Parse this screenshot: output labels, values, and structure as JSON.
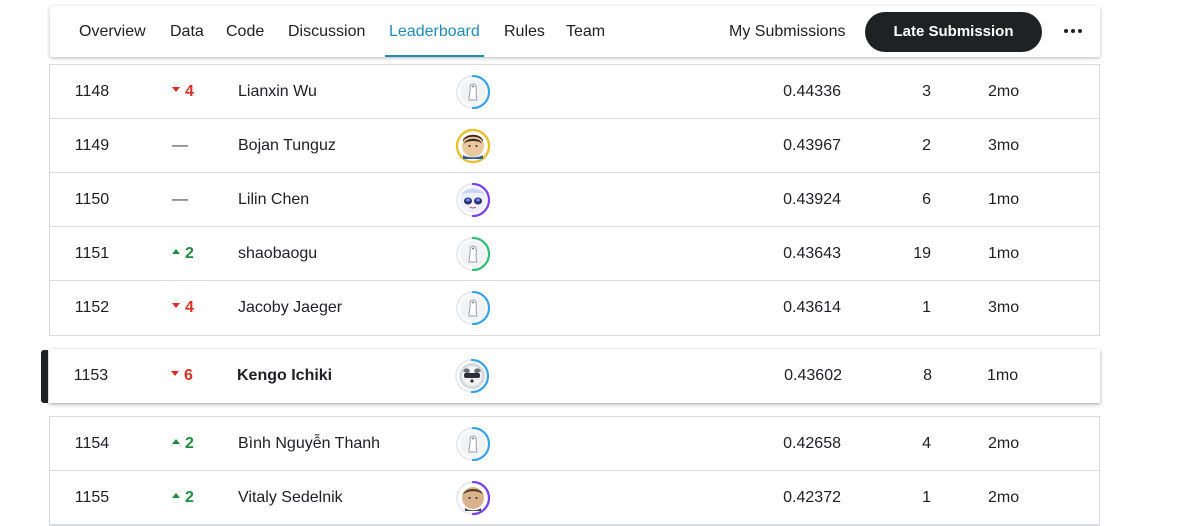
{
  "nav": {
    "tabs": [
      {
        "label": "Overview",
        "id": "overview"
      },
      {
        "label": "Data",
        "id": "data"
      },
      {
        "label": "Code",
        "id": "code"
      },
      {
        "label": "Discussion",
        "id": "discussion"
      },
      {
        "label": "Leaderboard",
        "id": "leaderboard",
        "active": true
      },
      {
        "label": "Rules",
        "id": "rules"
      },
      {
        "label": "Team",
        "id": "team"
      }
    ],
    "my_submissions": "My Submissions",
    "late_submission": "Late Submission",
    "more_icon": "more-horizontal-icon"
  },
  "colors": {
    "accent": "#1f8cb8",
    "rank_up": "#1e8e3e",
    "rank_down": "#d93025",
    "button_dark": "#202124"
  },
  "rows_top": [
    {
      "rank": "1148",
      "trend": "down",
      "change": "4",
      "name": "Lianxin Wu",
      "avatar": "default",
      "ring": "#3aa3e3",
      "score": "0.44336",
      "entries": "3",
      "last": "2mo"
    },
    {
      "rank": "1149",
      "trend": "same",
      "change": "—",
      "name": "Bojan Tunguz",
      "avatar": "photo",
      "ring": "#e8c02d",
      "score": "0.43967",
      "entries": "2",
      "last": "3mo"
    },
    {
      "rank": "1150",
      "trend": "same",
      "change": "—",
      "name": "Lilin Chen",
      "avatar": "anime",
      "ring": "#7a3ef0",
      "score": "0.43924",
      "entries": "6",
      "last": "1mo"
    },
    {
      "rank": "1151",
      "trend": "up",
      "change": "2",
      "name": "shaobaogu",
      "avatar": "default",
      "ring": "#2fbf71",
      "score": "0.43643",
      "entries": "19",
      "last": "1mo"
    },
    {
      "rank": "1152",
      "trend": "down",
      "change": "4",
      "name": "Jacoby Jaeger",
      "avatar": "default",
      "ring": "#3aa3e3",
      "score": "0.43614",
      "entries": "1",
      "last": "3mo"
    }
  ],
  "row_highlight": {
    "rank": "1153",
    "trend": "down",
    "change": "6",
    "name": "Kengo Ichiki",
    "avatar": "dog",
    "ring": "#3aa3e3",
    "score": "0.43602",
    "entries": "8",
    "last": "1mo"
  },
  "rows_bottom": [
    {
      "rank": "1154",
      "trend": "up",
      "change": "2",
      "name": "Bình Nguyễn Thanh",
      "avatar": "default",
      "ring": "#3aa3e3",
      "score": "0.42658",
      "entries": "4",
      "last": "2mo"
    },
    {
      "rank": "1155",
      "trend": "up",
      "change": "2",
      "name": "Vitaly Sedelnik",
      "avatar": "photo2",
      "ring": "#7a3ef0",
      "score": "0.42372",
      "entries": "1",
      "last": "2mo"
    }
  ]
}
